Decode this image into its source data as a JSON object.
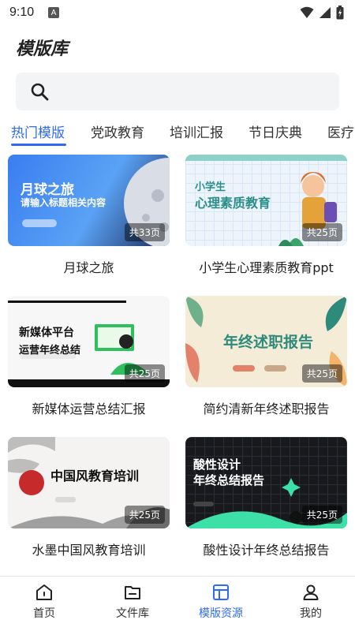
{
  "status": {
    "time": "9:10",
    "indicator": "A"
  },
  "page": {
    "title": "模版库"
  },
  "search": {
    "placeholder": ""
  },
  "tabs": [
    {
      "label": "热门模版",
      "active": true
    },
    {
      "label": "党政教育"
    },
    {
      "label": "培训汇报"
    },
    {
      "label": "节日庆典"
    },
    {
      "label": "医疗"
    }
  ],
  "templates": [
    {
      "title": "月球之旅",
      "pages": "共33页",
      "thumb_title": "月球之旅",
      "thumb_subtitle": "请输入标题相关内容"
    },
    {
      "title": "小学生心理素质教育ppt",
      "pages": "共25页",
      "thumb_title": "小学生",
      "thumb_subtitle": "心理素质教育"
    },
    {
      "title": "新媒体运营总结汇报",
      "pages": "共25页",
      "thumb_title": "新媒体平台",
      "thumb_subtitle": "运营年终总结"
    },
    {
      "title": "简约清新年终述职报告",
      "pages": "共25页",
      "thumb_title": "年终述职报告"
    },
    {
      "title": "水墨中国风教育培训",
      "pages": "共25页",
      "thumb_title": "中国风教育培训"
    },
    {
      "title": "酸性设计年终总结报告",
      "pages": "共25页",
      "thumb_title": "酸性设计",
      "thumb_subtitle": "年终总结报告"
    }
  ],
  "nav": [
    {
      "label": "首页",
      "icon": "home-icon"
    },
    {
      "label": "文件库",
      "icon": "folder-icon"
    },
    {
      "label": "模版资源",
      "icon": "template-icon",
      "active": true
    },
    {
      "label": "我的",
      "icon": "user-icon"
    }
  ],
  "colors": {
    "accent": "#2f6bf2"
  }
}
